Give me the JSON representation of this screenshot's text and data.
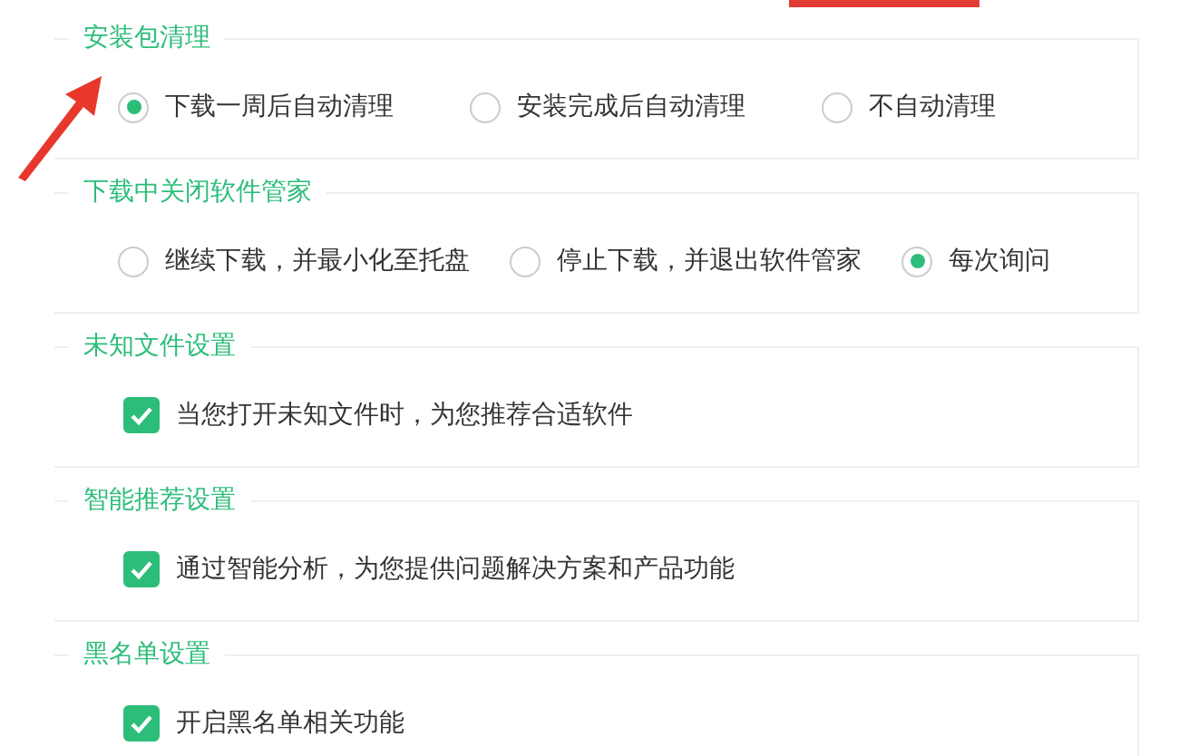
{
  "sections": [
    {
      "title": "安装包清理",
      "kind": "radio",
      "options": [
        {
          "label": "下载一周后自动清理",
          "selected": true
        },
        {
          "label": "安装完成后自动清理",
          "selected": false
        },
        {
          "label": "不自动清理",
          "selected": false
        }
      ]
    },
    {
      "title": "下载中关闭软件管家",
      "kind": "radio",
      "options": [
        {
          "label": "继续下载，并最小化至托盘",
          "selected": false
        },
        {
          "label": "停止下载，并退出软件管家",
          "selected": false
        },
        {
          "label": "每次询问",
          "selected": true
        }
      ]
    },
    {
      "title": "未知文件设置",
      "kind": "checkbox",
      "options": [
        {
          "label": "当您打开未知文件时，为您推荐合适软件",
          "checked": true
        }
      ]
    },
    {
      "title": "智能推荐设置",
      "kind": "checkbox",
      "options": [
        {
          "label": "通过智能分析，为您提供问题解决方案和产品功能",
          "checked": true
        }
      ]
    },
    {
      "title": "黑名单设置",
      "kind": "checkbox",
      "options": [
        {
          "label": "开启黑名单相关功能",
          "checked": true
        }
      ]
    }
  ]
}
